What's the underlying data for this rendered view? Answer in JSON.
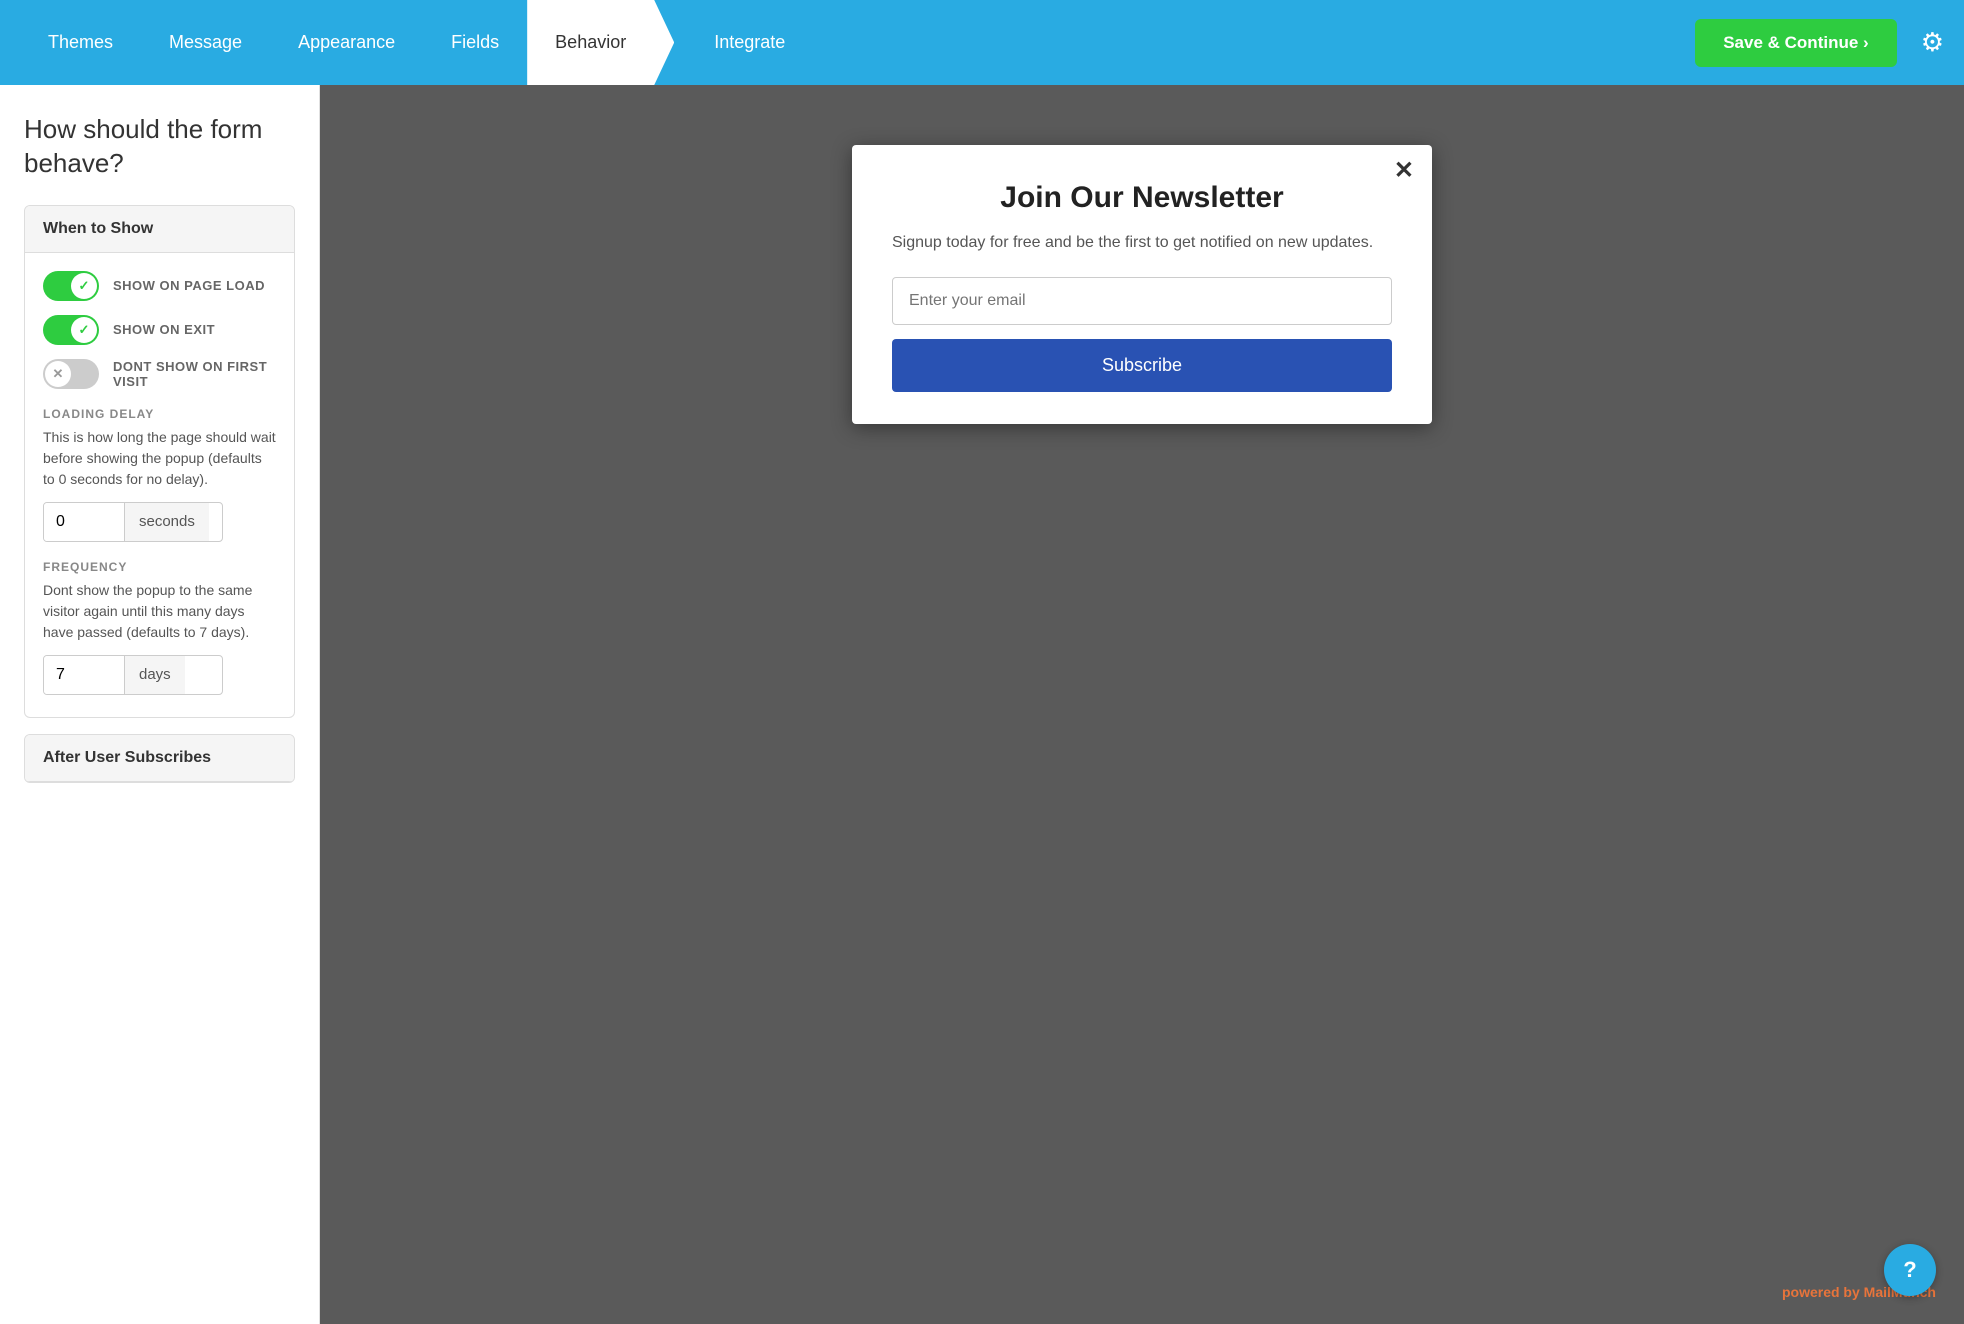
{
  "header": {
    "nav_items": [
      {
        "id": "themes",
        "label": "Themes",
        "active": false
      },
      {
        "id": "message",
        "label": "Message",
        "active": false
      },
      {
        "id": "appearance",
        "label": "Appearance",
        "active": false
      },
      {
        "id": "fields",
        "label": "Fields",
        "active": false
      },
      {
        "id": "behavior",
        "label": "Behavior",
        "active": true
      },
      {
        "id": "integrate",
        "label": "Integrate",
        "active": false
      }
    ],
    "save_button": "Save & Continue ›",
    "gear_icon": "⚙"
  },
  "left_panel": {
    "page_title": "How should the form behave?",
    "when_to_show": {
      "heading": "When to Show",
      "toggles": [
        {
          "id": "show-on-page-load",
          "label": "SHOW ON PAGE LOAD",
          "on": true
        },
        {
          "id": "show-on-exit",
          "label": "SHOW ON EXIT",
          "on": true
        },
        {
          "id": "dont-show-first-visit",
          "label": "DONT SHOW ON FIRST VISIT",
          "on": false
        }
      ],
      "loading_delay_label": "LOADING DELAY",
      "loading_delay_desc": "This is how long the page should wait before showing the popup (defaults to 0 seconds for no delay).",
      "loading_delay_value": "0",
      "loading_delay_unit": "seconds",
      "frequency_label": "FREQUENCY",
      "frequency_desc": "Dont show the popup to the same visitor again until this many days have passed (defaults to 7 days).",
      "frequency_value": "7",
      "frequency_unit": "days"
    },
    "after_subscribes": {
      "heading": "After User Subscribes"
    }
  },
  "popup": {
    "close_symbol": "✕",
    "title": "Join Our Newsletter",
    "subtitle": "Signup today for free and be the first to get notified on new updates.",
    "email_placeholder": "Enter your email",
    "subscribe_button": "Subscribe",
    "powered_by_prefix": "powered by ",
    "powered_by_brand": "MailMunch"
  },
  "help_button": "?"
}
